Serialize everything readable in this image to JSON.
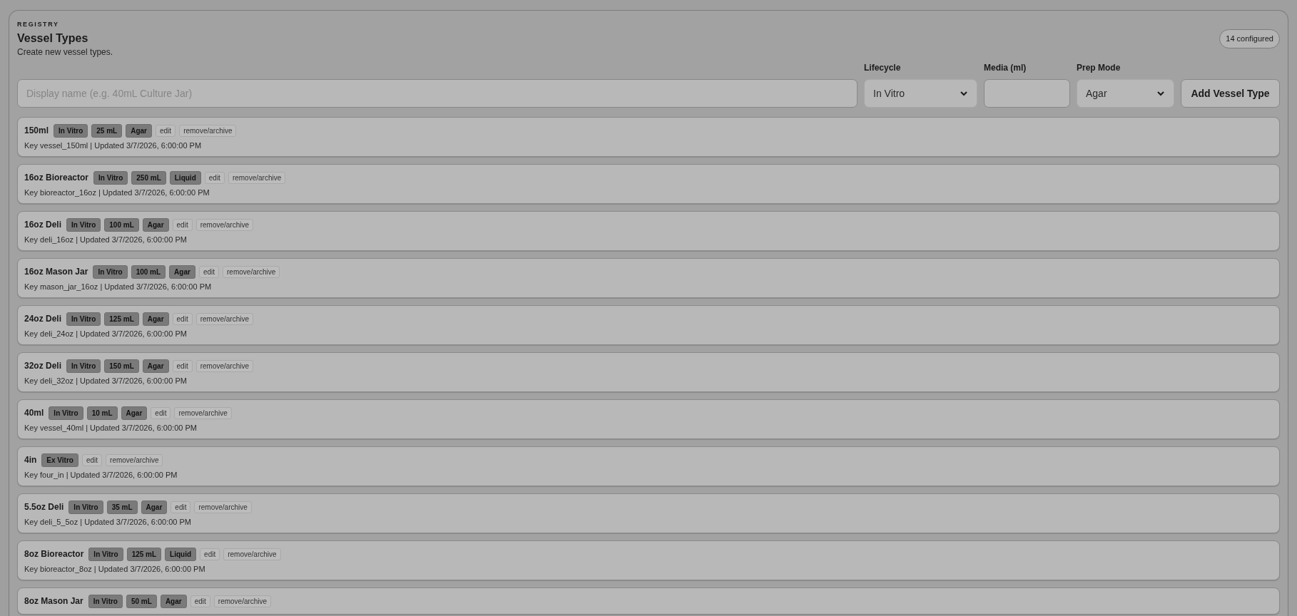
{
  "header": {
    "eyebrow": "REGISTRY",
    "title": "Vessel Types",
    "subtitle": "Create new vessel types.",
    "count_badge": "14 configured"
  },
  "form": {
    "fields": [
      {
        "kind": "text",
        "placeholder": "Display name (e.g. 40mL Culture Jar)"
      },
      {
        "kind": "select",
        "label": "Lifecycle",
        "value": "In Vitro"
      },
      {
        "kind": "number",
        "label": "Media (ml)"
      },
      {
        "kind": "select",
        "label": "Prep Mode",
        "value": "Agar"
      }
    ],
    "submit": "Add Vessel Type"
  },
  "vessels": [
    {
      "name": "150ml",
      "tags": [
        "In Vitro",
        "25 mL",
        "Agar"
      ],
      "actions": [
        "edit",
        "remove/archive"
      ],
      "meta": "Key vessel_150ml | Updated 3/7/2026, 6:00:00 PM"
    },
    {
      "name": "16oz Bioreactor",
      "tags": [
        "In Vitro",
        "250 mL",
        "Liquid"
      ],
      "actions": [
        "edit",
        "remove/archive"
      ],
      "meta": "Key bioreactor_16oz | Updated 3/7/2026, 6:00:00 PM"
    },
    {
      "name": "16oz Deli",
      "tags": [
        "In Vitro",
        "100 mL",
        "Agar"
      ],
      "actions": [
        "edit",
        "remove/archive"
      ],
      "meta": "Key deli_16oz | Updated 3/7/2026, 6:00:00 PM"
    },
    {
      "name": "16oz Mason Jar",
      "tags": [
        "In Vitro",
        "100 mL",
        "Agar"
      ],
      "actions": [
        "edit",
        "remove/archive"
      ],
      "meta": "Key mason_jar_16oz | Updated 3/7/2026, 6:00:00 PM"
    },
    {
      "name": "24oz Deli",
      "tags": [
        "In Vitro",
        "125 mL",
        "Agar"
      ],
      "actions": [
        "edit",
        "remove/archive"
      ],
      "meta": "Key deli_24oz | Updated 3/7/2026, 6:00:00 PM"
    },
    {
      "name": "32oz Deli",
      "tags": [
        "In Vitro",
        "150 mL",
        "Agar"
      ],
      "actions": [
        "edit",
        "remove/archive"
      ],
      "meta": "Key deli_32oz | Updated 3/7/2026, 6:00:00 PM"
    },
    {
      "name": "40ml",
      "tags": [
        "In Vitro",
        "10 mL",
        "Agar"
      ],
      "actions": [
        "edit",
        "remove/archive"
      ],
      "meta": "Key vessel_40ml | Updated 3/7/2026, 6:00:00 PM"
    },
    {
      "name": "4in",
      "tags": [
        "Ex Vitro"
      ],
      "actions": [
        "edit",
        "remove/archive"
      ],
      "meta": "Key four_in | Updated 3/7/2026, 6:00:00 PM"
    },
    {
      "name": "5.5oz Deli",
      "tags": [
        "In Vitro",
        "35 mL",
        "Agar"
      ],
      "actions": [
        "edit",
        "remove/archive"
      ],
      "meta": "Key deli_5_5oz | Updated 3/7/2026, 6:00:00 PM"
    },
    {
      "name": "8oz Bioreactor",
      "tags": [
        "In Vitro",
        "125 mL",
        "Liquid"
      ],
      "actions": [
        "edit",
        "remove/archive"
      ],
      "meta": "Key bioreactor_8oz | Updated 3/7/2026, 6:00:00 PM"
    },
    {
      "name": "8oz Mason Jar",
      "tags": [
        "In Vitro",
        "50 mL",
        "Agar"
      ],
      "actions": [
        "edit",
        "remove/archive"
      ]
    }
  ]
}
